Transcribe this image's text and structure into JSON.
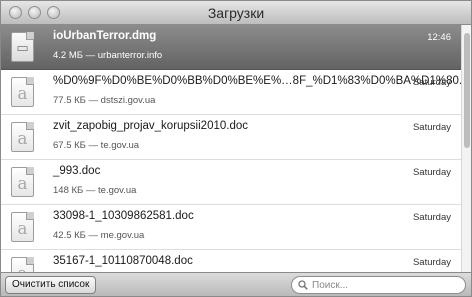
{
  "window": {
    "title": "Загрузки"
  },
  "downloads": [
    {
      "name": "ioUrbanTerror.dmg",
      "meta": "4.2 МБ — urbanterror.info",
      "time": "12:46",
      "selected": true,
      "icon": "disk-image-icon"
    },
    {
      "name": "%D0%9F%D0%BE%D0%BB%D0%BE%E%…8F_%D1%83%D0%BA%D1%80.doc",
      "meta": "77.5 КБ — dstszi.gov.ua",
      "time": "Saturday",
      "selected": false,
      "icon": "document-icon"
    },
    {
      "name": "zvit_zapobig_projav_korupsii2010.doc",
      "meta": "67.5 КБ — te.gov.ua",
      "time": "Saturday",
      "selected": false,
      "icon": "document-icon"
    },
    {
      "name": "_993.doc",
      "meta": "148 КБ — te.gov.ua",
      "time": "Saturday",
      "selected": false,
      "icon": "document-icon"
    },
    {
      "name": "33098-1_10309862581.doc",
      "meta": "42.5 КБ — me.gov.ua",
      "time": "Saturday",
      "selected": false,
      "icon": "document-icon"
    },
    {
      "name": "35167-1_10110870048.doc",
      "meta": "",
      "time": "Saturday",
      "selected": false,
      "icon": "document-icon"
    }
  ],
  "footer": {
    "clear_label": "Очистить список",
    "search_placeholder": "Поиск..."
  }
}
